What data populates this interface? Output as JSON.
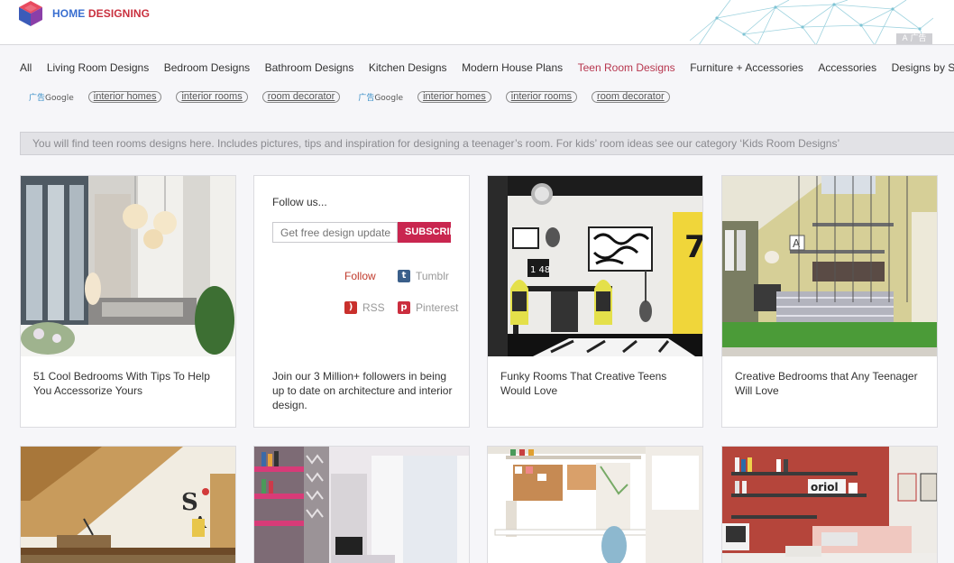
{
  "brand": {
    "home": "HOME",
    "designing": "DESIGNING"
  },
  "header": {
    "ad_badge": "A 广告"
  },
  "nav": [
    {
      "label": "All"
    },
    {
      "label": "Living Room Designs"
    },
    {
      "label": "Bedroom Designs"
    },
    {
      "label": "Bathroom Designs"
    },
    {
      "label": "Kitchen Designs"
    },
    {
      "label": "Modern House Plans"
    },
    {
      "label": "Teen Room Designs",
      "active": true
    },
    {
      "label": "Furniture + Accessories"
    },
    {
      "label": "Accessories"
    },
    {
      "label": "Designs by Sty"
    }
  ],
  "ads": {
    "google_cn": "广告",
    "google": "Google",
    "pills": [
      "interior homes",
      "interior rooms",
      "room decorator",
      "interior homes",
      "interior rooms",
      "room decorator"
    ]
  },
  "description": "You will find teen rooms designs here. Includes pictures, tips and inspiration for designing a teenager’s room. For kids’ room ideas see our category ‘Kids Room Designs’",
  "cards": [
    {
      "title": "51 Cool Bedrooms With Tips To Help You Accessorize Yours"
    },
    {
      "title": "Funky Rooms That Creative Teens Would Love"
    },
    {
      "title": "Creative Bedrooms that Any Teenager Will Love"
    }
  ],
  "follow": {
    "title": "Follow us...",
    "email_placeholder": "Get free design update",
    "subscribe": "SUBSCRIBE",
    "follow_link": "Follow",
    "tumblr": "Tumblr",
    "rss": "RSS",
    "pinterest": "Pinterest",
    "text": "Join our 3 Million+ followers in being up to date on architecture and interior design."
  },
  "photo_text": {
    "clock": "1 48",
    "sign": "7",
    "wall_letters": "A",
    "brand_sign": "oriol"
  },
  "colors": {
    "accent": "#c9264f",
    "active_nav": "#b7364e",
    "logo_blue": "#3a6fd0",
    "logo_red": "#c9303e"
  }
}
